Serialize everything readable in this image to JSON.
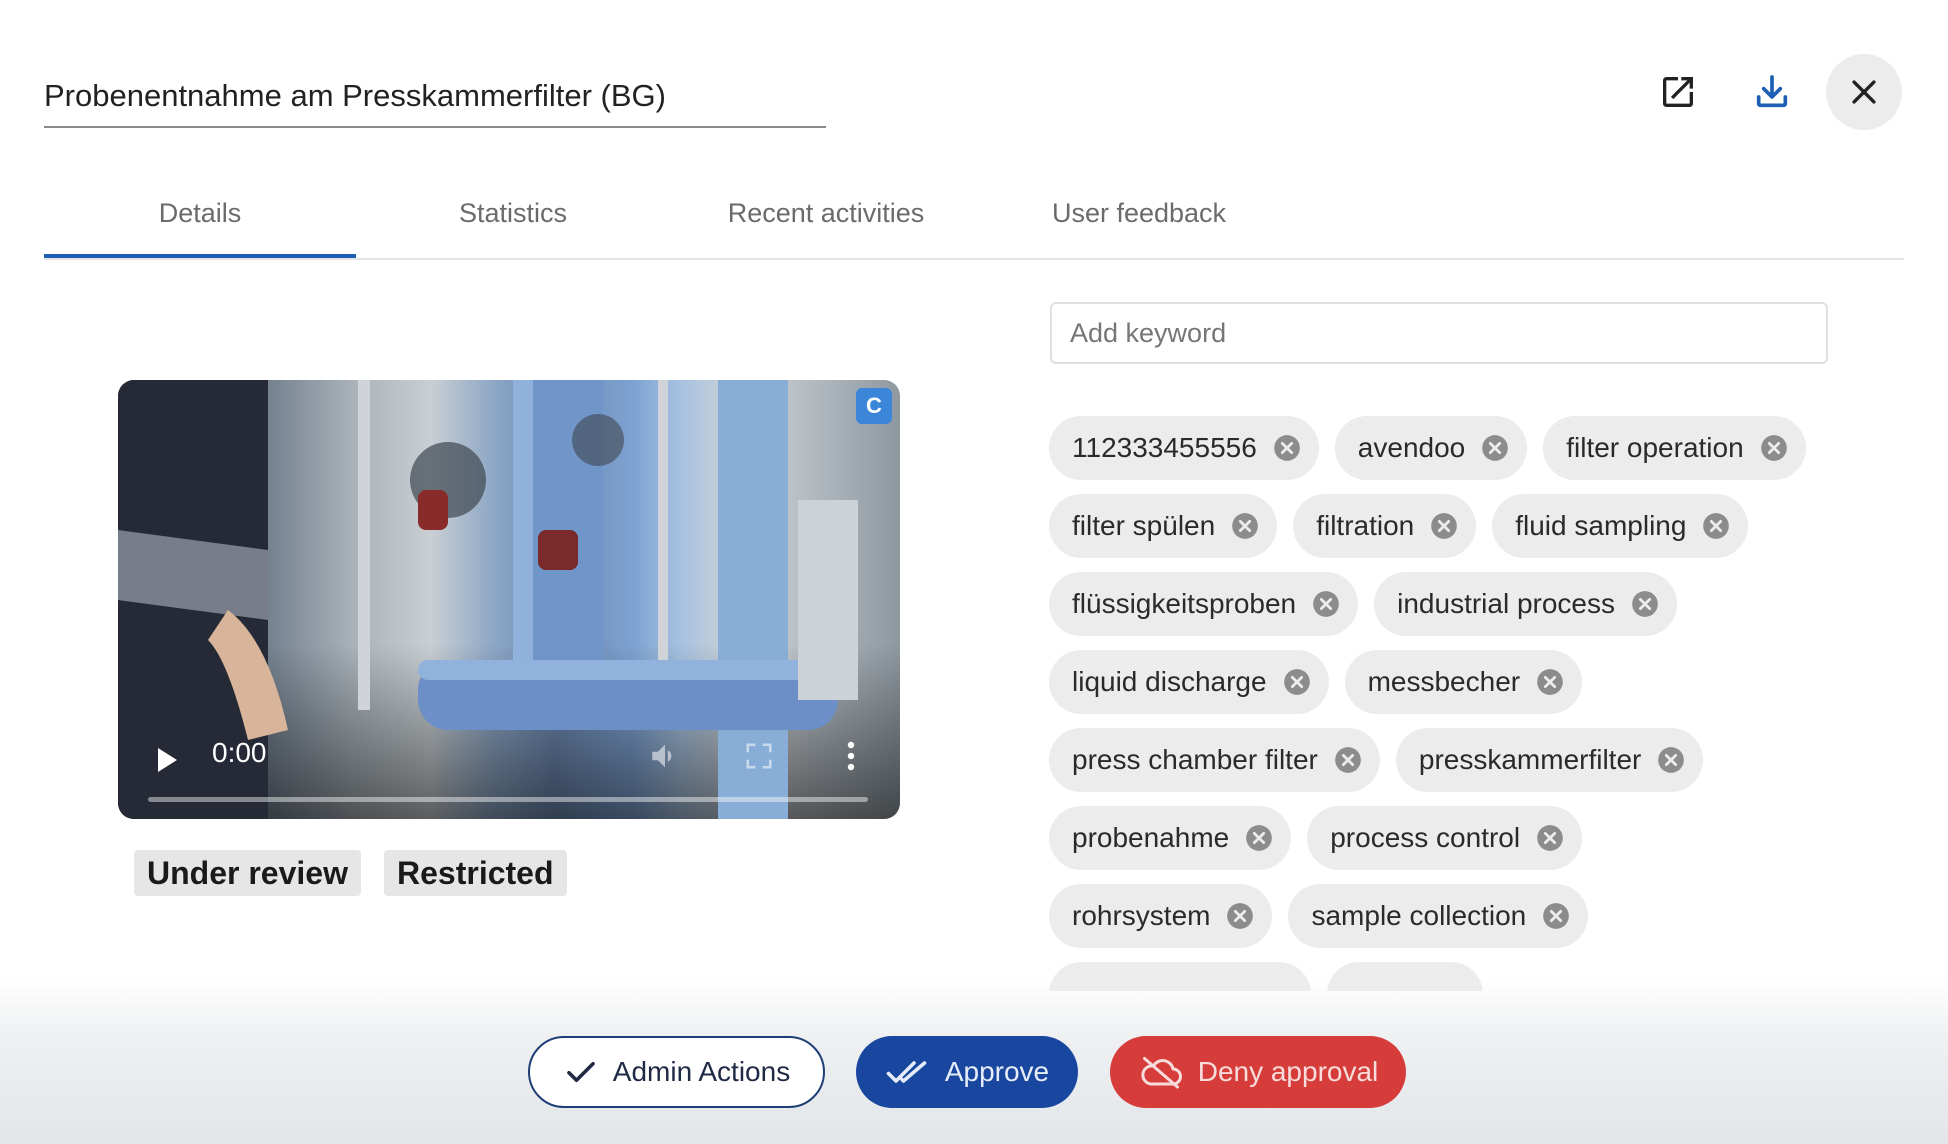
{
  "header": {
    "title": "Probenentnahme am Presskammerfilter (BG)",
    "icons": [
      "open-external-icon",
      "download-icon",
      "close-icon"
    ]
  },
  "tabs": [
    {
      "label": "Details",
      "active": true
    },
    {
      "label": "Statistics",
      "active": false
    },
    {
      "label": "Recent activities",
      "active": false
    },
    {
      "label": "User feedback",
      "active": false
    }
  ],
  "video": {
    "time": "0:00",
    "badge": "C",
    "icons": [
      "play-icon",
      "volume-icon",
      "fullscreen-icon",
      "more-vert-icon"
    ]
  },
  "status": {
    "review": "Under review",
    "restricted": "Restricted"
  },
  "keywords": {
    "placeholder": "Add keyword",
    "items": [
      "112333455556",
      "avendoo",
      "filter operation",
      "filter spülen",
      "filtration",
      "fluid sampling",
      "flüssigkeitsproben",
      "industrial process",
      "liquid discharge",
      "messbecher",
      "press chamber filter",
      "presskammerfilter",
      "probenahme",
      "process control",
      "rohrsystem",
      "sample collection"
    ]
  },
  "actions": {
    "admin": "Admin Actions",
    "approve": "Approve",
    "deny": "Deny approval"
  },
  "colors": {
    "accent": "#1d5fb4",
    "approve": "#1947a0",
    "deny": "#d63c3a"
  }
}
